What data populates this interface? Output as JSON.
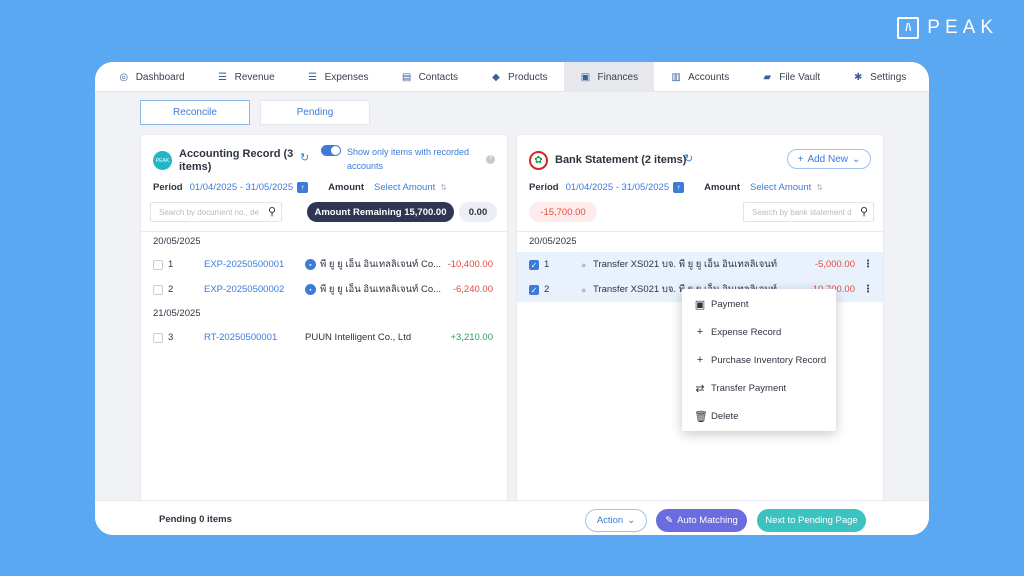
{
  "brand": {
    "name": "PEAK",
    "logo_glyph": "/\\"
  },
  "nav": {
    "items": [
      {
        "label": "Dashboard",
        "icon": "dashboard-icon"
      },
      {
        "label": "Revenue",
        "icon": "revenue-icon"
      },
      {
        "label": "Expenses",
        "icon": "expenses-icon"
      },
      {
        "label": "Contacts",
        "icon": "contacts-icon"
      },
      {
        "label": "Products",
        "icon": "products-icon"
      },
      {
        "label": "Finances",
        "icon": "finances-icon",
        "active": true
      },
      {
        "label": "Accounts",
        "icon": "accounts-icon"
      },
      {
        "label": "File Vault",
        "icon": "folder-icon"
      },
      {
        "label": "Settings",
        "icon": "gear-icon"
      }
    ]
  },
  "subtabs": {
    "reconcile": "Reconcile",
    "pending": "Pending"
  },
  "accounting": {
    "avatar": "PEAK",
    "title": "Accounting Record (3 items)",
    "toggle_label": "Show only items with recorded accounts",
    "toggle_on": true,
    "period_label": "Period",
    "period_value": "01/04/2025 - 31/05/2025",
    "amount_label": "Amount",
    "amount_value": "Select Amount",
    "search_placeholder": "Search by document no., de",
    "remaining": "Amount Remaining 15,700.00",
    "zero": "0.00",
    "groups": [
      {
        "date": "20/05/2025"
      },
      {
        "date": "21/05/2025"
      }
    ],
    "rows": [
      {
        "num": "1",
        "doc": "EXP-20250500001",
        "contact": "พี ยู ยู เอ็น อินเทลลิเจนท์ Co...",
        "amount": "-10,400.00"
      },
      {
        "num": "2",
        "doc": "EXP-20250500002",
        "contact": "พี ยู ยู เอ็น อินเทลลิเจนท์ Co...",
        "amount": "-6,240.00"
      },
      {
        "num": "3",
        "doc": "RT-20250500001",
        "contact": "PUUN Intelligent Co., Ltd",
        "amount": "+3,210.00"
      }
    ]
  },
  "bank": {
    "title": "Bank Statement (2 items)",
    "add_new": "Add New",
    "period_label": "Period",
    "period_value": "01/04/2025 - 31/05/2025",
    "amount_label": "Amount",
    "amount_value": "Select Amount",
    "search_placeholder": "Search by bank statement d",
    "balance": "-15,700.00",
    "date": "20/05/2025",
    "rows": [
      {
        "num": "1",
        "desc": "Transfer XS021 บจ. พี ยู ยู เอ็น อินเทลลิเจนท์",
        "amount": "-5,000.00"
      },
      {
        "num": "2",
        "desc": "Transfer XS021 บจ. พี ยู ยู เอ็น อินเทลลิเจนท์",
        "amount": "-10,700.00"
      }
    ]
  },
  "context_menu": {
    "items": [
      {
        "label": "Payment",
        "icon": "cash-icon"
      },
      {
        "label": "Expense Record",
        "icon": "plus-icon"
      },
      {
        "label": "Purchase Inventory Record",
        "icon": "plus-icon"
      },
      {
        "label": "Transfer Payment",
        "icon": "transfer-icon"
      },
      {
        "label": "Delete",
        "icon": "trash-icon"
      }
    ]
  },
  "footer": {
    "pending": "Pending 0 items",
    "action": "Action",
    "auto_matching": "Auto Matching",
    "next": "Next to Pending Page"
  },
  "colors": {
    "background": "#5aa7f2",
    "accent": "#3d7bd8",
    "negative": "#e44c3c",
    "positive": "#27a15b",
    "auto_matching": "#6b6ce0",
    "next_button": "#3cc3c0",
    "remaining_pill": "#2f3654"
  }
}
